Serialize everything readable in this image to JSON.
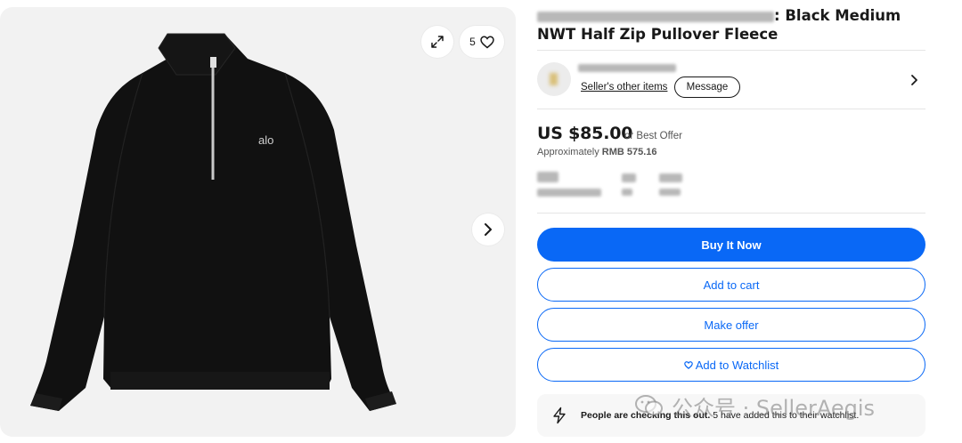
{
  "gallery": {
    "watch_count": "5",
    "brand_logo_text": "alo",
    "icons": {
      "expand": "expand-icon",
      "heart": "heart-icon",
      "next": "chevron-right-icon"
    }
  },
  "listing": {
    "title_visible": ": Black Medium NWT Half Zip Pullover Fleece"
  },
  "seller": {
    "other_items_link": "Seller's other items",
    "message_button": "Message"
  },
  "pricing": {
    "price": "US $85.00",
    "best_offer": "or Best Offer",
    "approx_label": "Approximately",
    "approx_value": "RMB 575.16"
  },
  "actions": {
    "buy_now": "Buy It Now",
    "add_to_cart": "Add to cart",
    "make_offer": "Make offer",
    "add_to_watchlist": "Add to Watchlist"
  },
  "activity": {
    "headline": "People are checking this out.",
    "detail": "5 have added this to their watchlist."
  },
  "watermark": {
    "text": "公众号 · SellerAegis"
  },
  "colors": {
    "accent_blue": "#0968f6",
    "gallery_bg": "#f2f2f2"
  }
}
